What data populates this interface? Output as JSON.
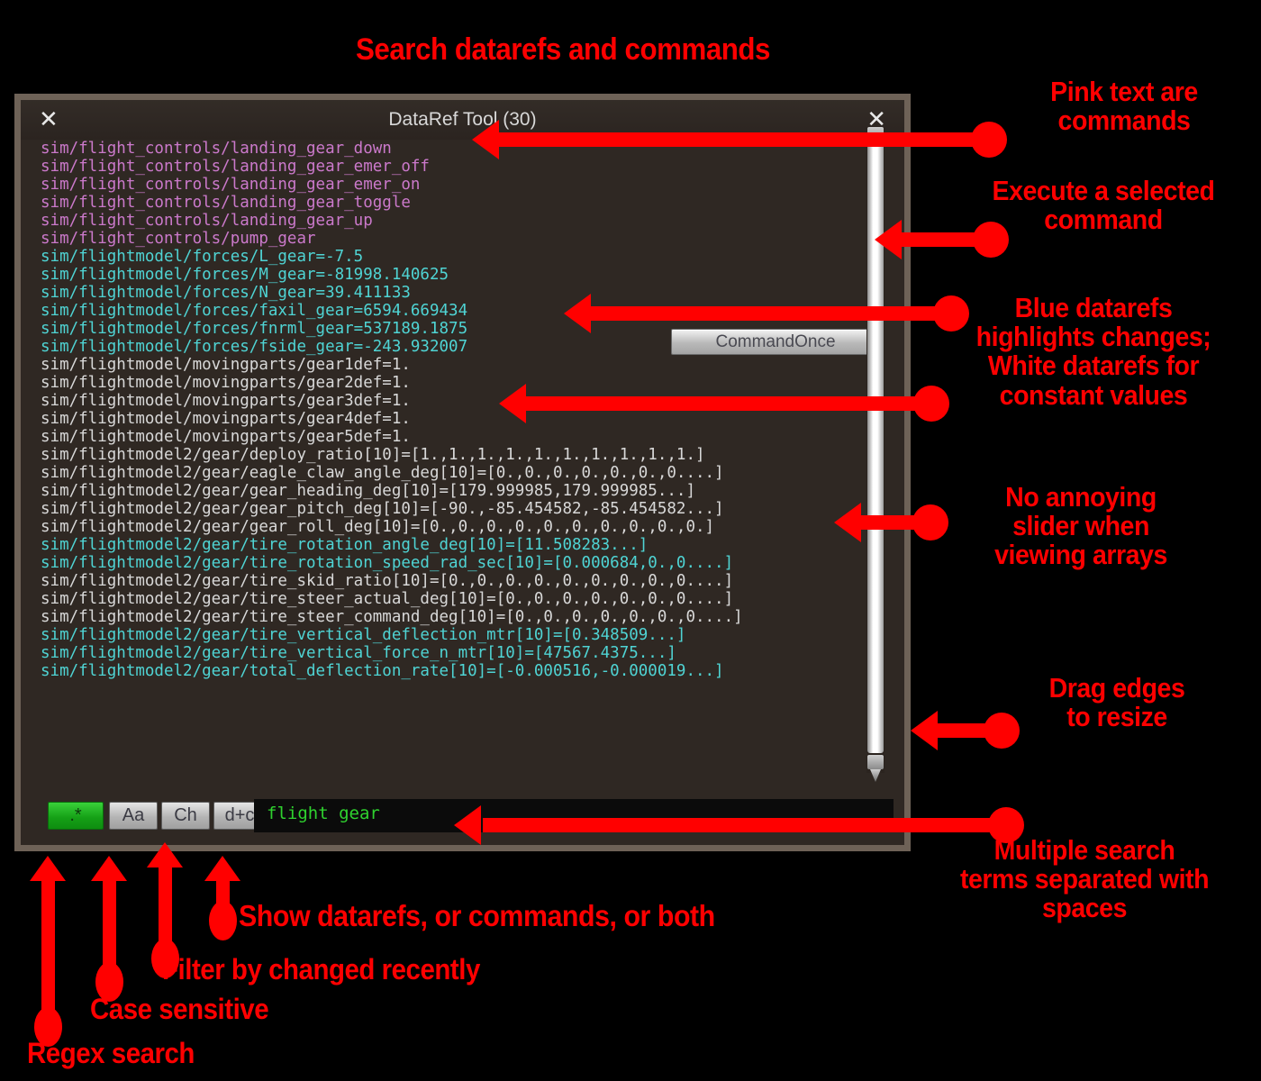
{
  "annotations": {
    "title": "Search datarefs and commands",
    "pink_text": "Pink text are\ncommands",
    "execute": "Execute a selected\ncommand",
    "blue_white": "Blue datarefs\nhighlights changes;\nWhite datarefs for\nconstant values",
    "no_slider": "No annoying\nslider when\nviewing arrays",
    "drag_edges": "Drag edges\nto resize",
    "multiple_terms": "Multiple search\nterms separated with\nspaces",
    "show_both": "Show datarefs, or commands, or both",
    "filter_changed": "Filter by changed recently",
    "case_sensitive": "Case sensitive",
    "regex_search": "Regex search"
  },
  "window": {
    "title": "DataRef Tool (30)",
    "close_left_icon": "✕",
    "close_right_icon": "✕",
    "command_once_label": "CommandOnce"
  },
  "toolbar": {
    "buttons": [
      {
        "label": ".*",
        "name": "regex-toggle",
        "active": true
      },
      {
        "label": "Aa",
        "name": "case-toggle",
        "active": false
      },
      {
        "label": "Ch",
        "name": "changed-toggle",
        "active": false
      },
      {
        "label": "d+c",
        "name": "type-toggle",
        "active": false
      }
    ],
    "search_value": "flight gear"
  },
  "colors": {
    "command": "#cb79cb",
    "changed": "#4fd4d4",
    "static": "#d8d8d8",
    "annotation": "#ff0000",
    "search_text": "#2fd22f"
  },
  "list": [
    {
      "text": "sim/flight_controls/landing_gear_down",
      "kind": "cmd"
    },
    {
      "text": "sim/flight_controls/landing_gear_emer_off",
      "kind": "cmd"
    },
    {
      "text": "sim/flight_controls/landing_gear_emer_on",
      "kind": "cmd"
    },
    {
      "text": "sim/flight_controls/landing_gear_toggle",
      "kind": "cmd"
    },
    {
      "text": "sim/flight_controls/landing_gear_up",
      "kind": "cmd"
    },
    {
      "text": "sim/flight_controls/pump_gear",
      "kind": "cmd"
    },
    {
      "text": "sim/flightmodel/forces/L_gear=-7.5",
      "kind": "chg"
    },
    {
      "text": "sim/flightmodel/forces/M_gear=-81998.140625",
      "kind": "chg"
    },
    {
      "text": "sim/flightmodel/forces/N_gear=39.411133",
      "kind": "chg"
    },
    {
      "text": "sim/flightmodel/forces/faxil_gear=6594.669434",
      "kind": "chg"
    },
    {
      "text": "sim/flightmodel/forces/fnrml_gear=537189.1875",
      "kind": "chg"
    },
    {
      "text": "sim/flightmodel/forces/fside_gear=-243.932007",
      "kind": "chg"
    },
    {
      "text": "sim/flightmodel/movingparts/gear1def=1.",
      "kind": "sta"
    },
    {
      "text": "sim/flightmodel/movingparts/gear2def=1.",
      "kind": "sta"
    },
    {
      "text": "sim/flightmodel/movingparts/gear3def=1.",
      "kind": "sta"
    },
    {
      "text": "sim/flightmodel/movingparts/gear4def=1.",
      "kind": "sta"
    },
    {
      "text": "sim/flightmodel/movingparts/gear5def=1.",
      "kind": "sta"
    },
    {
      "text": "sim/flightmodel2/gear/deploy_ratio[10]=[1.,1.,1.,1.,1.,1.,1.,1.,1.,1.]",
      "kind": "sta"
    },
    {
      "text": "sim/flightmodel2/gear/eagle_claw_angle_deg[10]=[0.,0.,0.,0.,0.,0.,0....]",
      "kind": "sta"
    },
    {
      "text": "sim/flightmodel2/gear/gear_heading_deg[10]=[179.999985,179.999985...]",
      "kind": "sta"
    },
    {
      "text": "sim/flightmodel2/gear/gear_pitch_deg[10]=[-90.,-85.454582,-85.454582...]",
      "kind": "sta"
    },
    {
      "text": "sim/flightmodel2/gear/gear_roll_deg[10]=[0.,0.,0.,0.,0.,0.,0.,0.,0.,0.]",
      "kind": "sta"
    },
    {
      "text": "sim/flightmodel2/gear/tire_rotation_angle_deg[10]=[11.508283...]",
      "kind": "chg"
    },
    {
      "text": "sim/flightmodel2/gear/tire_rotation_speed_rad_sec[10]=[0.000684,0.,0....]",
      "kind": "chg"
    },
    {
      "text": "sim/flightmodel2/gear/tire_skid_ratio[10]=[0.,0.,0.,0.,0.,0.,0.,0.,0....]",
      "kind": "sta"
    },
    {
      "text": "sim/flightmodel2/gear/tire_steer_actual_deg[10]=[0.,0.,0.,0.,0.,0.,0....]",
      "kind": "sta"
    },
    {
      "text": "sim/flightmodel2/gear/tire_steer_command_deg[10]=[0.,0.,0.,0.,0.,0.,0....]",
      "kind": "sta"
    },
    {
      "text": "sim/flightmodel2/gear/tire_vertical_deflection_mtr[10]=[0.348509...]",
      "kind": "chg"
    },
    {
      "text": "sim/flightmodel2/gear/tire_vertical_force_n_mtr[10]=[47567.4375...]",
      "kind": "chg"
    },
    {
      "text": "sim/flightmodel2/gear/total_deflection_rate[10]=[-0.000516,-0.000019...]",
      "kind": "chg"
    }
  ]
}
